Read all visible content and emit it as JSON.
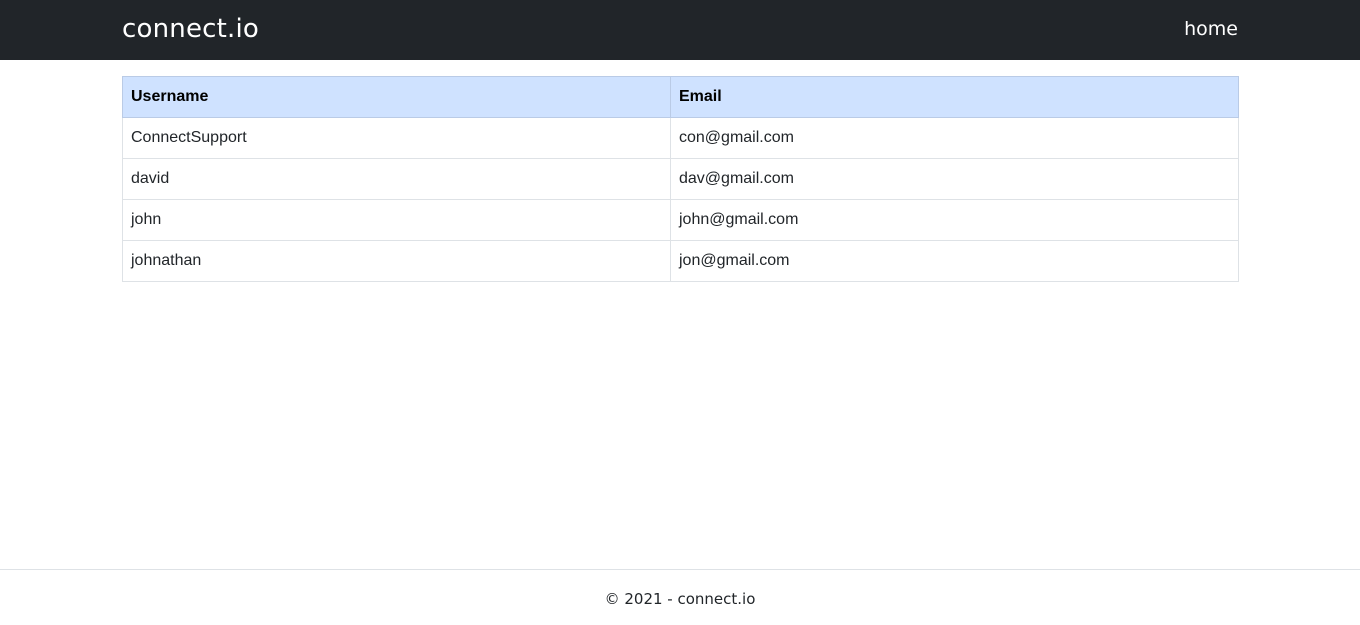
{
  "navbar": {
    "brand": "connect.io",
    "home_link": "home",
    "background": "#212529"
  },
  "table": {
    "headers": [
      "Username",
      "Email"
    ],
    "header_background": "#cfe2ff",
    "rows": [
      [
        "ConnectSupport",
        "con@gmail.com"
      ],
      [
        "david",
        "dav@gmail.com"
      ],
      [
        "john",
        "john@gmail.com"
      ],
      [
        "johnathan",
        "jon@gmail.com"
      ]
    ]
  },
  "footer": {
    "text": "© 2021 - connect.io"
  }
}
